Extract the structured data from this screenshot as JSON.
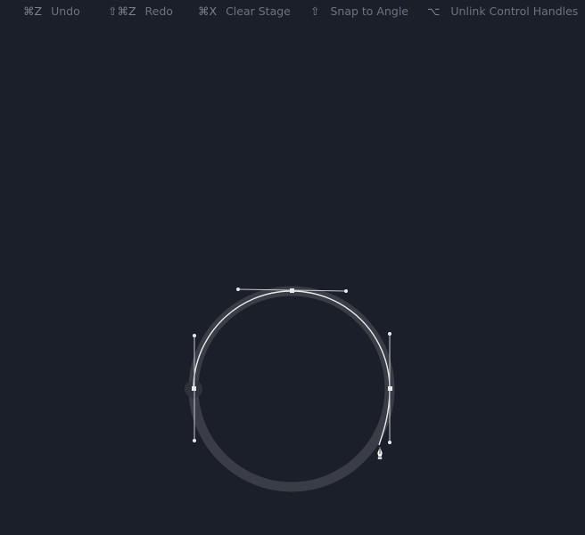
{
  "toolbar": {
    "shortcuts": [
      {
        "keys": "⌘Z",
        "label": "Undo"
      },
      {
        "keys": "⇧⌘Z",
        "label": "Redo"
      },
      {
        "keys": "⌘X",
        "label": "Clear Stage"
      },
      {
        "keys": "⇧",
        "label": "Snap to Angle"
      },
      {
        "keys": "⌥",
        "label": "Unlink Control Handles"
      }
    ]
  },
  "colors": {
    "background": "#1b1f2a",
    "stroke_shadow": "#3a3d46",
    "path": "#e8e9ec",
    "handle": "#c8cacf",
    "shortcut_text": "#6b7282"
  },
  "canvas": {
    "tool_cursor_icon": "pen-tool-icon"
  }
}
